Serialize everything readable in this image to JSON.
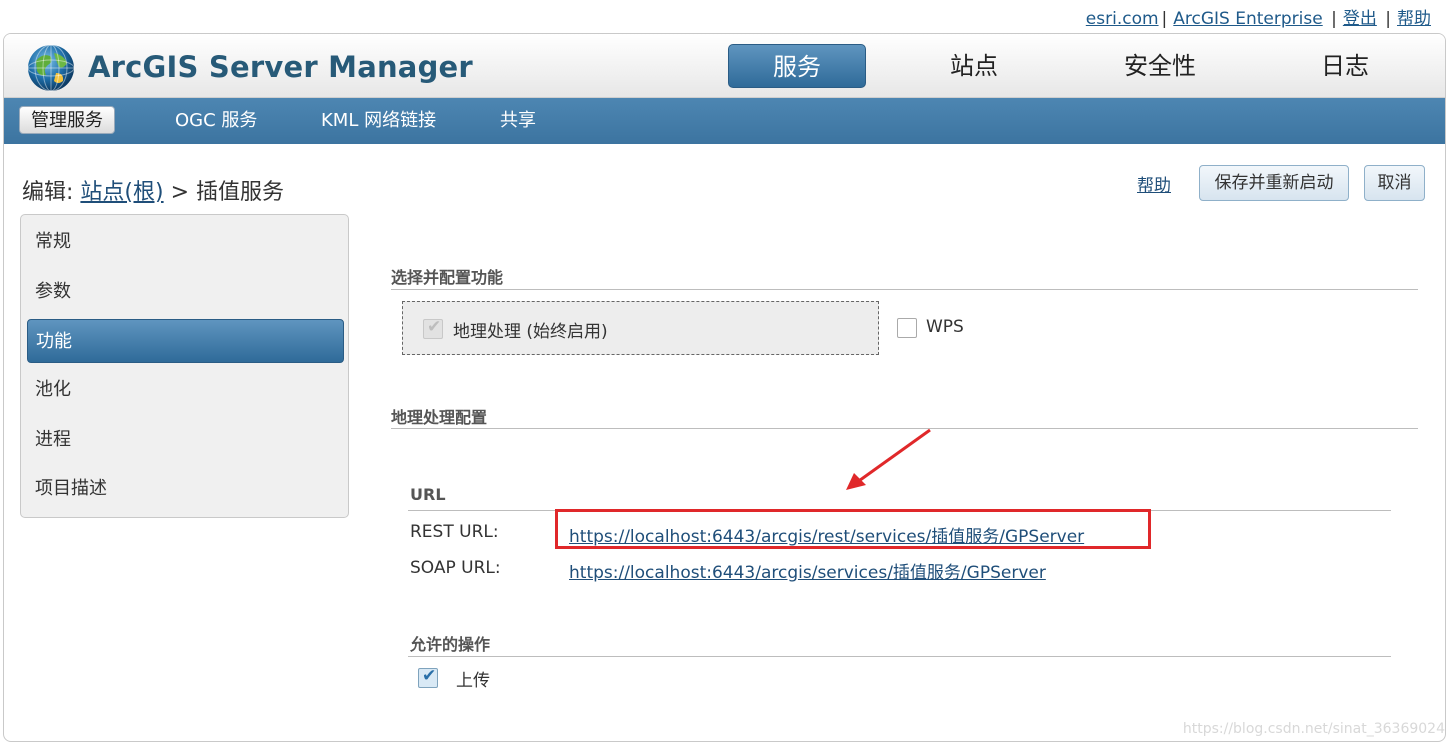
{
  "top_links": {
    "esri": "esri.com",
    "enterprise": "ArcGIS Enterprise",
    "logout": "登出",
    "help": "帮助"
  },
  "app": {
    "title": "ArcGIS Server Manager"
  },
  "main_nav": {
    "services": "服务",
    "site": "站点",
    "security": "安全性",
    "logs": "日志"
  },
  "sub_nav": {
    "manage": "管理服务",
    "ogc": "OGC 服务",
    "kml": "KML 网络链接",
    "share": "共享"
  },
  "breadcrumb": {
    "prefix": "编辑:",
    "site": "站点(根)",
    "sep": ">",
    "service": "插值服务"
  },
  "actions": {
    "help": "帮助",
    "save": "保存并重新启动",
    "cancel": "取消"
  },
  "side_menu": [
    "常规",
    "参数",
    "功能",
    "池化",
    "进程",
    "项目描述"
  ],
  "capabilities": {
    "title": "选择并配置功能",
    "geoprocessing": "地理处理 (始终启用)",
    "wps": "WPS"
  },
  "gp_config": {
    "title": "地理处理配置"
  },
  "url_section": {
    "title": "URL",
    "rest_label": "REST URL:",
    "rest_url": "https://localhost:6443/arcgis/rest/services/插值服务/GPServer",
    "soap_label": "SOAP URL:",
    "soap_url": "https://localhost:6443/arcgis/services/插值服务/GPServer"
  },
  "operations": {
    "title": "允许的操作",
    "upload": "上传"
  },
  "watermark": "https://blog.csdn.net/sinat_36369024",
  "colors": {
    "nav_blue": "#3c74a0",
    "highlight_red": "#e0282a",
    "link": "#1f4e79"
  }
}
